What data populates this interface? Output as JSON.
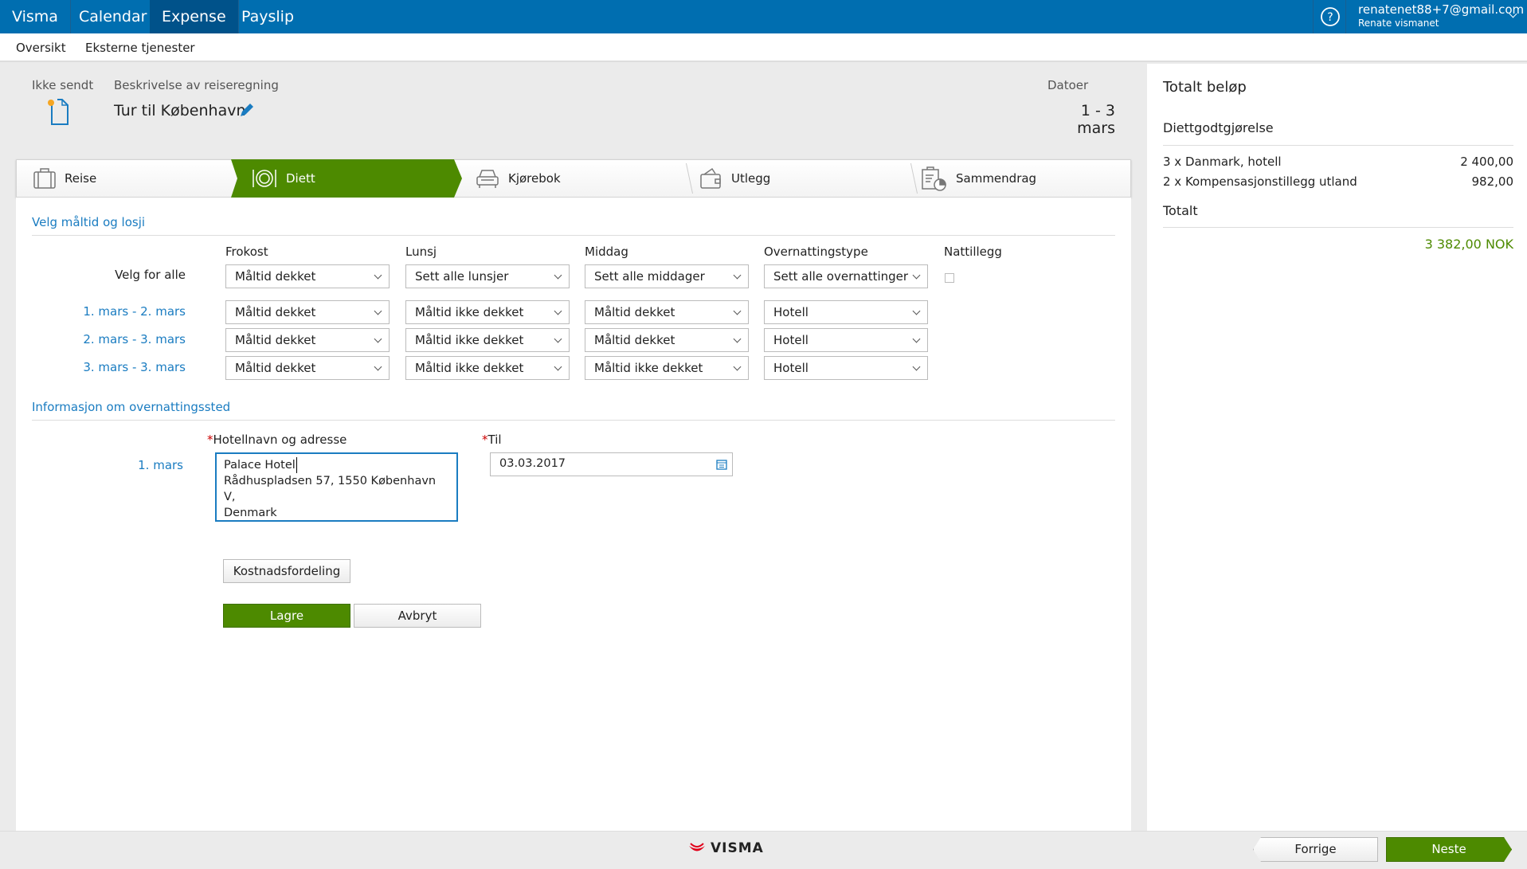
{
  "topbar": {
    "brand": "Visma",
    "nav": [
      "Calendar",
      "Expense",
      "Payslip"
    ],
    "active": "Expense",
    "email": "renatenet88+7@gmail.com",
    "user": "Renate vismanet"
  },
  "subnav": [
    "Oversikt",
    "Eksterne tjenester"
  ],
  "header": {
    "status": "Ikke sendt",
    "desc_label": "Beskrivelse av reiseregning",
    "title": "Tur til København",
    "dates_label": "Datoer",
    "dates": "1 - 3 mars"
  },
  "steps": [
    "Reise",
    "Diett",
    "Kjørebok",
    "Utlegg",
    "Sammendrag"
  ],
  "meals": {
    "title": "Velg måltid og losji",
    "columns": [
      "Frokost",
      "Lunsj",
      "Middag",
      "Overnattingstype",
      "Nattillegg"
    ],
    "all_label": "Velg for alle",
    "all": [
      "Måltid dekket",
      "Sett alle lunsjer",
      "Sett alle middager",
      "Sett alle overnattinger"
    ],
    "rows": [
      {
        "label": "1. mars - 2. mars",
        "values": [
          "Måltid dekket",
          "Måltid ikke dekket",
          "Måltid dekket",
          "Hotell"
        ]
      },
      {
        "label": "2. mars - 3. mars",
        "values": [
          "Måltid dekket",
          "Måltid ikke dekket",
          "Måltid dekket",
          "Hotell"
        ]
      },
      {
        "label": "3. mars - 3. mars",
        "values": [
          "Måltid dekket",
          "Måltid ikke dekket",
          "Måltid ikke dekket",
          "Hotell"
        ]
      }
    ]
  },
  "lodging": {
    "title": "Informasjon om overnattingssted",
    "hotel_label": "Hotellnavn og adresse",
    "to_label": "Til",
    "date_label": "1. mars",
    "hotel_lines": [
      "Palace Hotel",
      "Rådhuspladsen 57, 1550 København V,",
      "Denmark"
    ],
    "to_value": "03.03.2017"
  },
  "buttons": {
    "cost": "Kostnadsfordeling",
    "save": "Lagre",
    "cancel": "Avbryt",
    "prev": "Forrige",
    "next": "Neste"
  },
  "footer": {
    "logo": "VISMA"
  },
  "summary": {
    "title": "Totalt beløp",
    "section": "Diettgodtgjørelse",
    "items": [
      {
        "label": "3 x Danmark, hotell",
        "value": "2 400,00"
      },
      {
        "label": "2 x Kompensasjonstillegg utland",
        "value": "982,00"
      }
    ],
    "total_label": "Totalt",
    "total": "3 382,00 NOK"
  },
  "colors": {
    "brand": "#006eb0",
    "accent": "#4d8a00",
    "link": "#1a7cc1"
  }
}
